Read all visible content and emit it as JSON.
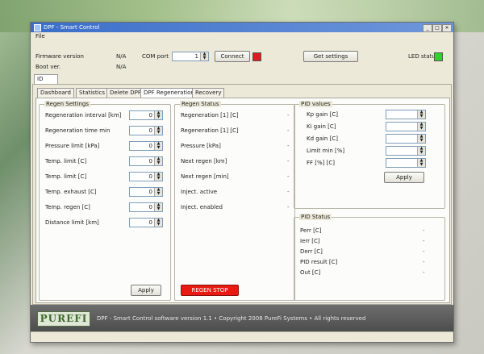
{
  "window": {
    "title": "DPF - Smart Control",
    "menu": "File"
  },
  "top": {
    "firmware_label": "Firmware version",
    "firmware_value": "N/A",
    "boot_label": "Boot ver.",
    "boot_value": "N/A",
    "com_label": "COM port",
    "com_value": "1",
    "connect_label": "Connect",
    "connect_status_color": "#d81e1e",
    "get_settings_label": "Get settings",
    "led_label": "LED status",
    "led_color": "#2dd42d",
    "top_tab": "ID"
  },
  "tabs": [
    "Dashboard",
    "Statistics",
    "Delete DPF",
    "DPF Regeneration",
    "Recovery"
  ],
  "active_tab_index": 3,
  "regen_settings": {
    "title": "Regen Settings",
    "rows": [
      {
        "label": "Regeneration interval [km]",
        "value": "0"
      },
      {
        "label": "Regeneration time min",
        "value": "0"
      },
      {
        "label": "Pressure limit [kPa]",
        "value": "0"
      },
      {
        "label": "Temp. limit [C]",
        "value": "0"
      },
      {
        "label": "Temp. limit [C]",
        "value": "0"
      },
      {
        "label": "Temp. exhaust [C]",
        "value": "0"
      },
      {
        "label": "Temp. regen [C]",
        "value": "0"
      },
      {
        "label": "Distance limit [km]",
        "value": "0"
      }
    ],
    "apply_label": "Apply"
  },
  "regen_status": {
    "title": "Regen Status",
    "rows": [
      {
        "label": "Regeneration [1] [C]",
        "value": "-"
      },
      {
        "label": "Regeneration [1] [C]",
        "value": "-"
      },
      {
        "label": "Pressure [kPa]",
        "value": "-"
      },
      {
        "label": "Next regen [km]",
        "value": "-"
      },
      {
        "label": "Next regen [min]",
        "value": "-"
      },
      {
        "label": "Inject. active",
        "value": "-"
      },
      {
        "label": "Inject. enabled",
        "value": "-"
      }
    ],
    "button_label": "REGEN STOP",
    "button_color": "#e81b12"
  },
  "pid_values": {
    "title": "PID values",
    "rows": [
      {
        "label": "Kp gain [C]"
      },
      {
        "label": "Ki gain [C]"
      },
      {
        "label": "Kd gain [C]"
      },
      {
        "label": "Limit min [%]"
      },
      {
        "label": "FF [%] [C]"
      }
    ],
    "apply_label": "Apply"
  },
  "pid_status": {
    "title": "PID Status",
    "rows": [
      {
        "label": "Perr [C]",
        "value": "-"
      },
      {
        "label": "Ierr [C]",
        "value": "-"
      },
      {
        "label": "Derr [C]",
        "value": "-"
      },
      {
        "label": "PID result [C]",
        "value": "-"
      },
      {
        "label": "Out [C]",
        "value": "-"
      }
    ]
  },
  "footer": {
    "logo": "PUREFI",
    "text": "DPF - Smart Control software version 1.1 • Copyright 2008 PureFi Systems • All rights reserved"
  }
}
